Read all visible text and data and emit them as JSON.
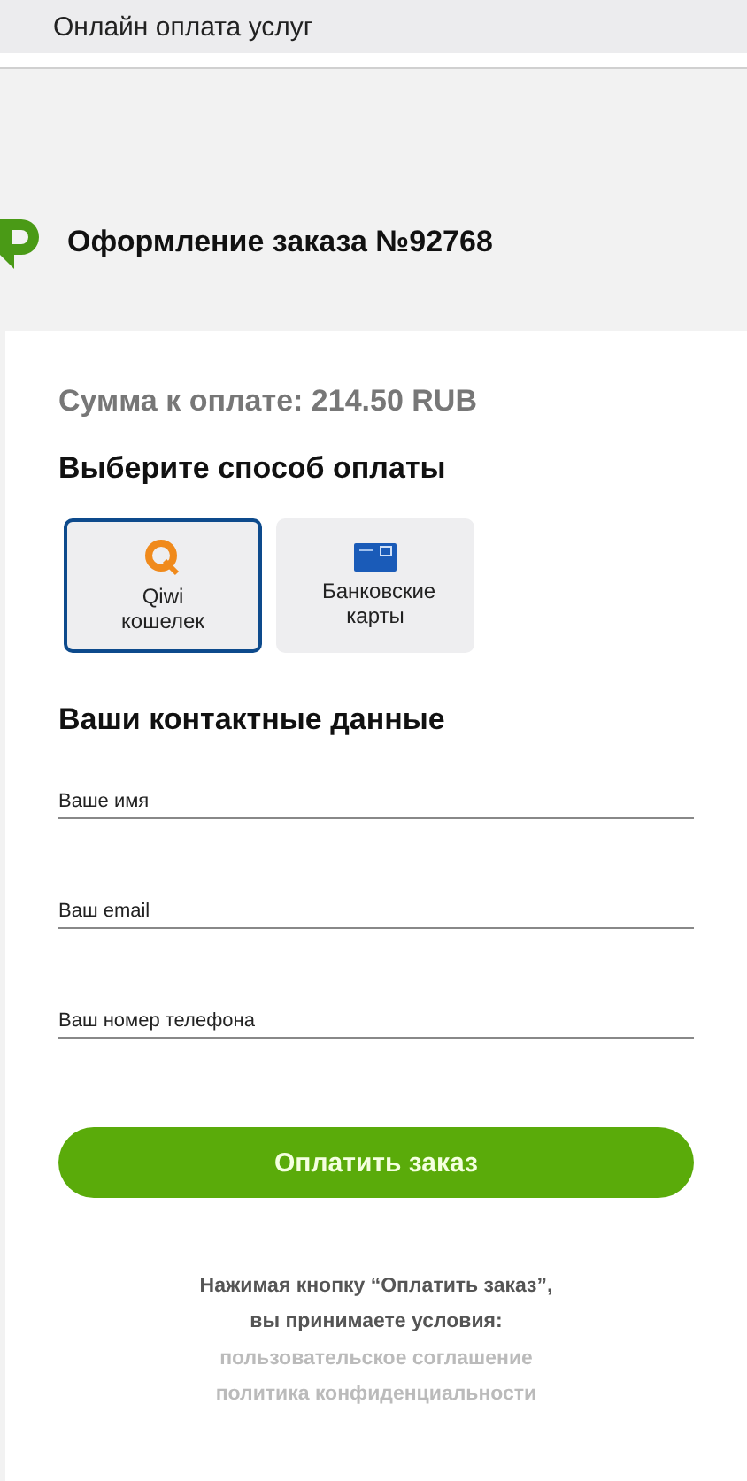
{
  "window": {
    "title": "Онлайн оплата услуг"
  },
  "header": {
    "title": "Оформление заказа №92768"
  },
  "amount": "Сумма к оплате: 214.50 RUB",
  "payment": {
    "title": "Выберите способ оплаты",
    "methods": [
      {
        "kind": "qiwi",
        "label": "Qiwi кошелек",
        "selected": true
      },
      {
        "kind": "card",
        "label": "Банковские карты",
        "selected": false
      }
    ]
  },
  "contacts": {
    "title": "Ваши контактные данные",
    "fields": [
      {
        "placeholder": "Ваше имя"
      },
      {
        "placeholder": "Ваш email"
      },
      {
        "placeholder": "Ваш номер телефона"
      }
    ]
  },
  "submit": "Оплатить заказ",
  "terms": {
    "text": "Нажимая кнопку “Оплатить заказ”, вы принимаете условия:",
    "links": [
      "пользовательское соглашение",
      "политика конфиденциальности"
    ]
  }
}
